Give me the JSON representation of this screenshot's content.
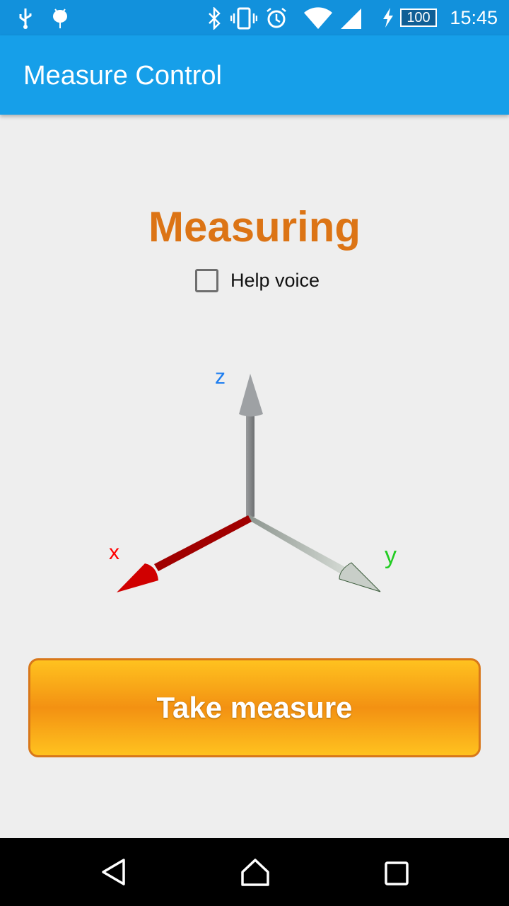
{
  "status_bar": {
    "time": "15:45",
    "battery": "100",
    "icons": [
      "usb-icon",
      "android-icon",
      "bluetooth-icon",
      "vibrate-icon",
      "alarm-icon",
      "wifi-icon",
      "signal-icon",
      "charging-icon",
      "battery-icon"
    ]
  },
  "app_bar": {
    "title": "Measure Control"
  },
  "main": {
    "heading": "Measuring",
    "help_voice_label": "Help voice",
    "help_voice_checked": false,
    "axes": {
      "x_label": "x",
      "y_label": "y",
      "z_label": "z"
    },
    "take_measure_label": "Take measure"
  },
  "colors": {
    "status_bar": "#1291dc",
    "app_bar": "#169fe9",
    "heading": "#dc7415",
    "button": "#f39112"
  }
}
